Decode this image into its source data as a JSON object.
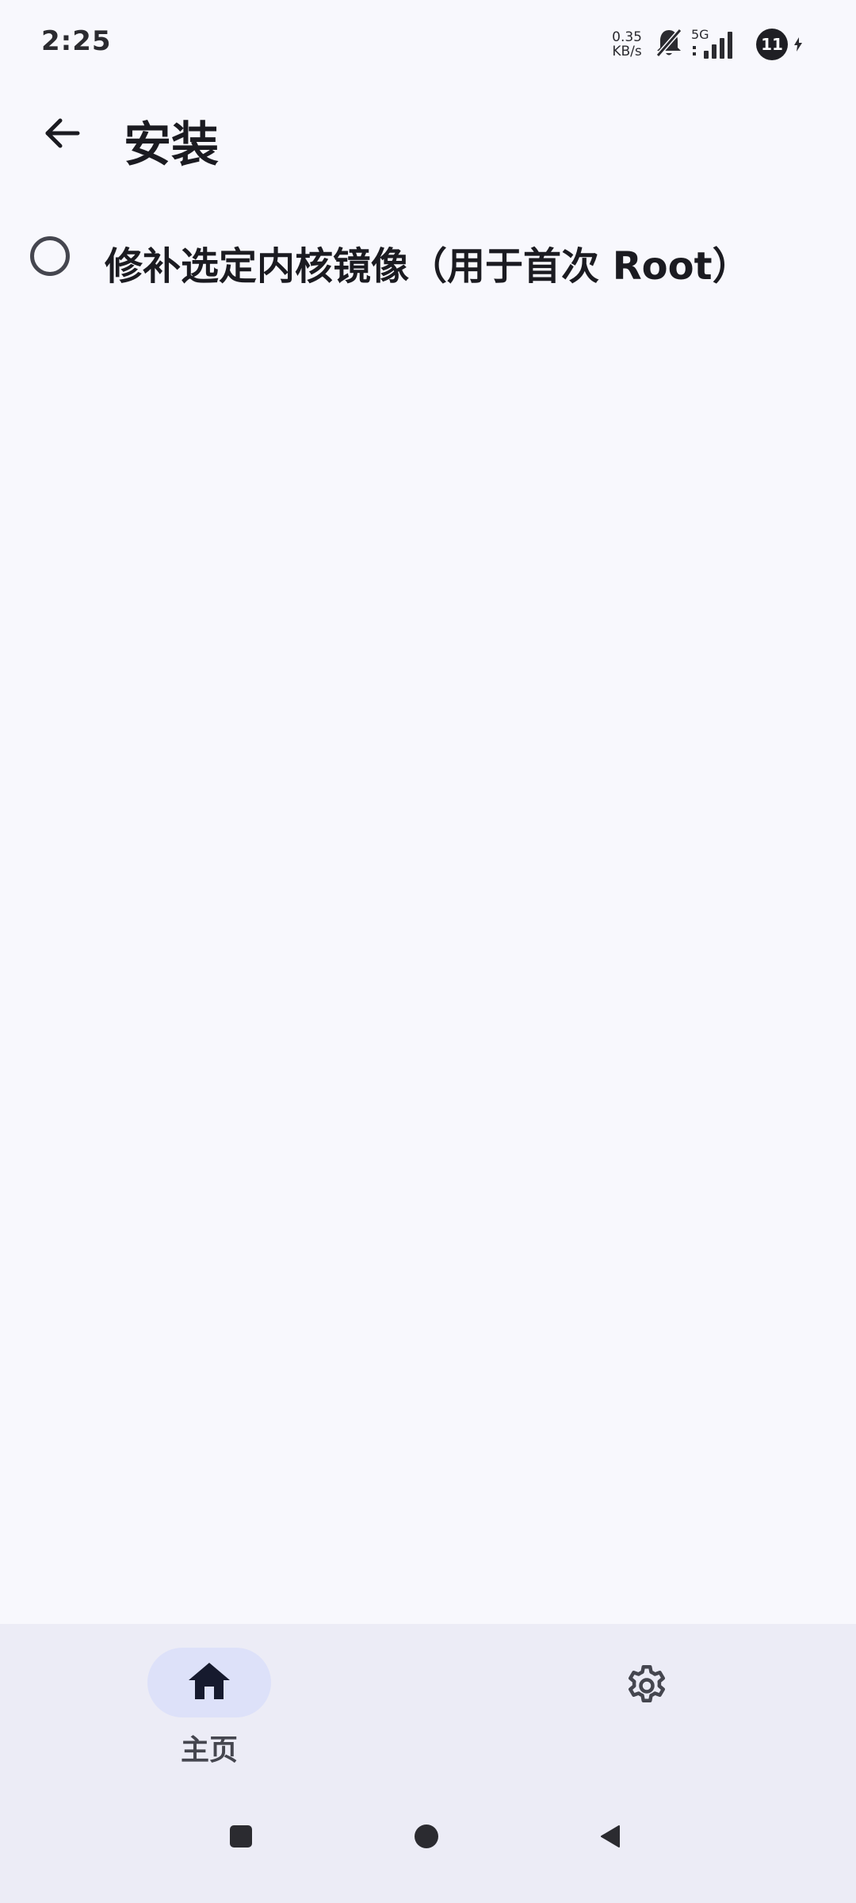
{
  "status_bar": {
    "time": "2:25",
    "net_speed_value": "0.35",
    "net_speed_unit": "KB/s",
    "network_type": "5G",
    "battery_level": "11",
    "icons": [
      "muted-bell-icon",
      "signal-icon",
      "battery-icon",
      "charging-icon"
    ]
  },
  "top_bar": {
    "title": "安装",
    "back_icon": "arrow-left-icon"
  },
  "options": [
    {
      "label": "修补选定内核镜像（用于首次 Root）",
      "selected": false
    }
  ],
  "bottom_nav": {
    "items": [
      {
        "label": "主页",
        "icon": "home-icon",
        "active": true
      },
      {
        "label": "",
        "icon": "gear-icon",
        "active": false
      }
    ]
  },
  "system_nav": {
    "icons": [
      "recents-icon",
      "home-circle-icon",
      "back-triangle-icon"
    ]
  },
  "colors": {
    "background": "#f8f8fd",
    "nav_background": "#ececf6",
    "active_pill": "#dde1f9",
    "text_primary": "#1b1b21",
    "text_secondary": "#45464f"
  }
}
